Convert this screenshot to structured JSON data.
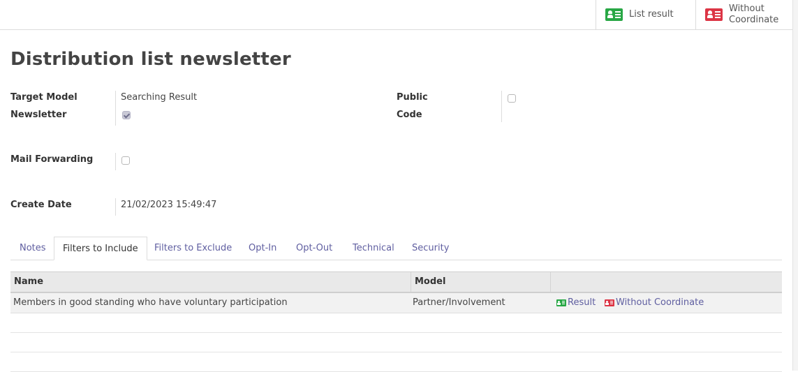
{
  "toolbar": {
    "list_result_label": "List result",
    "without_coordinate_line1": "Without",
    "without_coordinate_line2": "Coordinate"
  },
  "record": {
    "title": "Distribution list newsletter"
  },
  "form": {
    "target_model_label": "Target Model",
    "target_model_value": "Searching Result",
    "newsletter_label": "Newsletter",
    "newsletter_checked": true,
    "public_label": "Public",
    "public_checked": false,
    "code_label": "Code",
    "code_value": "",
    "mail_forwarding_label": "Mail Forwarding",
    "mail_forwarding_checked": false,
    "create_date_label": "Create Date",
    "create_date_value": "21/02/2023 15:49:47"
  },
  "tabs": [
    {
      "label": "Notes",
      "active": false
    },
    {
      "label": "Filters to Include",
      "active": true
    },
    {
      "label": "Filters to Exclude",
      "active": false
    },
    {
      "label": "Opt-In",
      "active": false
    },
    {
      "label": "Opt-Out",
      "active": false
    },
    {
      "label": "Technical",
      "active": false
    },
    {
      "label": "Security",
      "active": false
    }
  ],
  "filters_table": {
    "columns": [
      "Name",
      "Model",
      ""
    ],
    "rows": [
      {
        "name": "Members in good standing who have voluntary participation",
        "model": "Partner/Involvement",
        "result_action": "Result",
        "without_coordinate_action": "Without Coordinate"
      }
    ]
  },
  "colors": {
    "link": "#5f5ea0",
    "green_icon": "#28a745",
    "red_icon": "#dc3545",
    "header_bg": "#e9e9e9"
  },
  "icons": {
    "list_result": "green-contact-card-icon",
    "without_coordinate": "red-contact-card-icon"
  }
}
